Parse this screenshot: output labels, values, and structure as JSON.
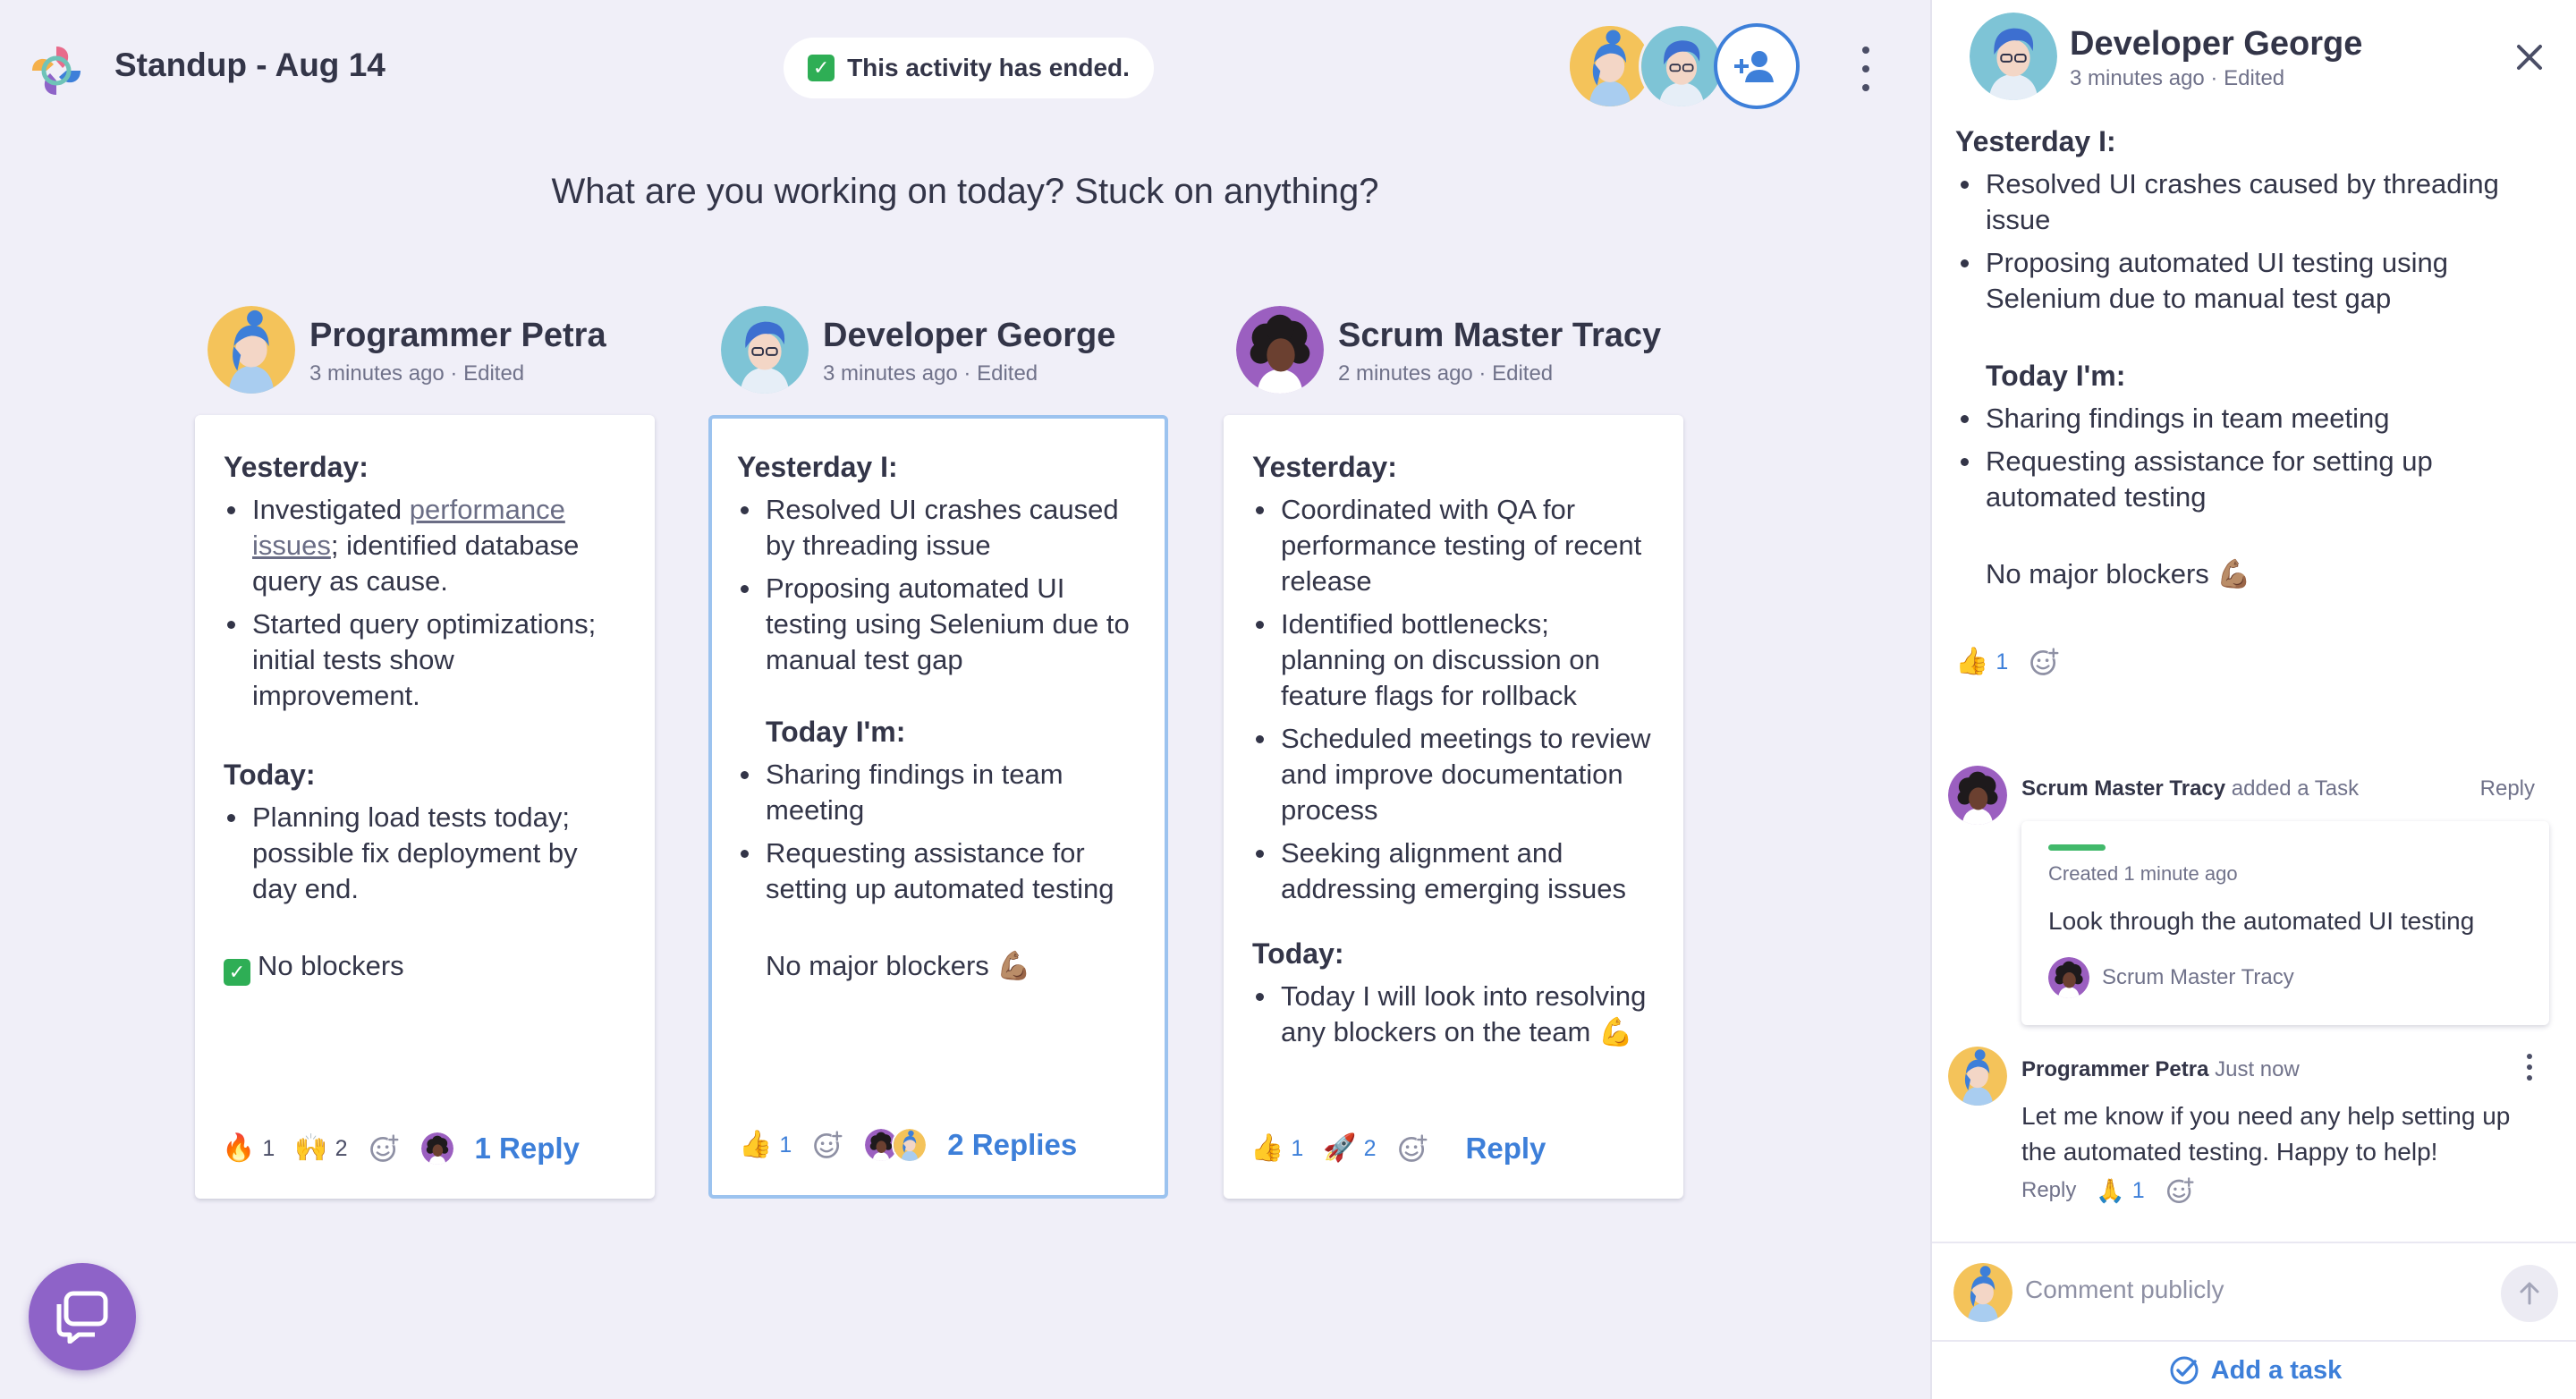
{
  "app": {
    "title": "Standup - Aug 14",
    "status": "This activity has ended.",
    "prompt": "What are you working on today? Stuck on anything?"
  },
  "colors": {
    "accent": "#3d7fd9",
    "bg": "#f0eff8",
    "chat_bubble": "#8e63c8",
    "check": "#2eae55"
  },
  "columns": [
    {
      "name": "Programmer Petra",
      "meta": "3 minutes ago · Edited",
      "section1": "Yesterday:",
      "y_items": [
        {
          "pre": "Investigated ",
          "link": "performance issues",
          "post": "; identified database query as cause."
        },
        {
          "text": "Started query optimizations; initial tests show improvement."
        }
      ],
      "section2": "Today:",
      "t_items": [
        "Planning load tests today; possible fix deployment by day end."
      ],
      "note": "No blockers",
      "reactions": [
        {
          "emoji": "🔥",
          "count": "1"
        },
        {
          "emoji": "🙌",
          "count": "2"
        }
      ],
      "reply_label": "1 Reply"
    },
    {
      "name": "Developer George",
      "meta": "3 minutes ago · Edited",
      "section1": "Yesterday I:",
      "y_items": [
        "Resolved UI crashes caused by threading issue",
        "Proposing automated UI testing using Selenium due to manual test gap"
      ],
      "section2": "Today I'm:",
      "t_items": [
        "Sharing findings in team meeting",
        "Requesting assistance for setting up automated testing"
      ],
      "note": "No major blockers 💪🏽",
      "reactions": [
        {
          "emoji": "👍",
          "count": "1"
        }
      ],
      "reply_label": "2 Replies"
    },
    {
      "name": "Scrum Master Tracy",
      "meta": "2 minutes ago · Edited",
      "section1": "Yesterday:",
      "y_items": [
        "Coordinated with QA for performance testing of recent release",
        "Identified bottlenecks; planning on discussion on feature flags for rollback",
        "Scheduled meetings to review and improve documentation process",
        "Seeking alignment and addressing emerging issues"
      ],
      "section2": "Today:",
      "t_items": [
        "Today I will look into resolving any blockers on the team 💪"
      ],
      "reactions": [
        {
          "emoji": "👍",
          "count": "1"
        },
        {
          "emoji": "🚀",
          "count": "2"
        }
      ],
      "reply_label": "Reply"
    }
  ],
  "panel": {
    "name": "Developer George",
    "meta": "3 minutes ago · Edited",
    "section1": "Yesterday I:",
    "y_items": [
      "Resolved UI crashes caused by threading issue",
      "Proposing automated UI testing using Selenium due to manual test gap"
    ],
    "section2": "Today I'm:",
    "t_items": [
      "Sharing findings in team meeting",
      "Requesting assistance for setting up automated testing"
    ],
    "note": "No major blockers 💪🏽",
    "reaction": {
      "emoji": "👍",
      "count": "1"
    },
    "comments": [
      {
        "author": "Scrum Master Tracy",
        "action": "added a Task",
        "reply": "Reply",
        "task": {
          "created": "Created 1 minute ago",
          "title": "Look through the automated UI testing",
          "assignee": "Scrum Master Tracy"
        }
      },
      {
        "author": "Programmer Petra",
        "time": "Just now",
        "text": "Let me know if you need any help setting up the automated testing. Happy to help!",
        "reply": "Reply",
        "reaction": {
          "emoji": "🙏",
          "count": "1"
        }
      }
    ],
    "composer_placeholder": "Comment publicly",
    "add_task": "Add a task"
  },
  "icons": [
    "app-logo-icon",
    "add-user-icon",
    "more-vertical-icon",
    "close-icon",
    "add-reaction-icon",
    "send-arrow-icon",
    "task-check-icon",
    "chat-bubble-icon"
  ]
}
